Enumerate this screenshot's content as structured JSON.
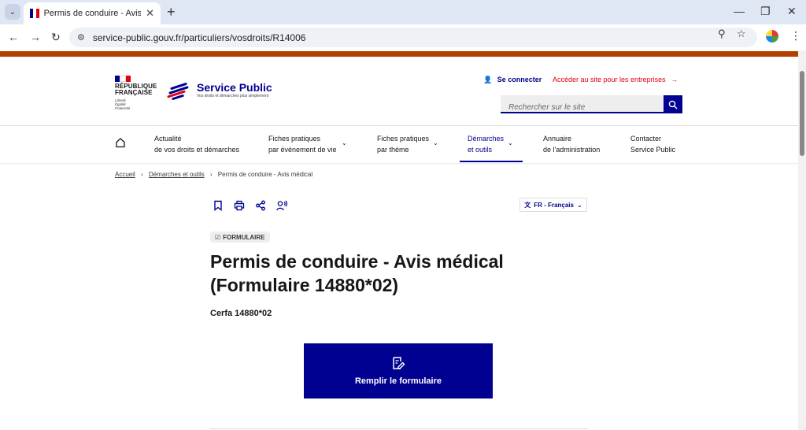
{
  "browser": {
    "tab_title": "Permis de conduire - Avis médical",
    "url": "service-public.gouv.fr/particuliers/vosdroits/R14006"
  },
  "header": {
    "marianne_lines": [
      "RÉPUBLIQUE",
      "FRANÇAISE"
    ],
    "devise": [
      "Liberté",
      "Égalité",
      "Fraternité"
    ],
    "site_title": "Service Public",
    "site_tagline": "Vos droits et démarches plus simplement",
    "connect_label": "Se connecter",
    "pro_link": "Accéder au site pour les entreprises",
    "search_placeholder": "Rechercher sur le site"
  },
  "nav": {
    "items": [
      {
        "line1": "Actualité",
        "line2": "de vos droits et démarches"
      },
      {
        "line1": "Fiches pratiques",
        "line2": "par événement de vie"
      },
      {
        "line1": "Fiches pratiques",
        "line2": "par thème"
      },
      {
        "line1": "Démarches",
        "line2": "et outils"
      },
      {
        "line1": "Annuaire",
        "line2": "de l'administration"
      },
      {
        "line1": "Contacter",
        "line2": "Service Public"
      }
    ]
  },
  "breadcrumb": {
    "items": [
      "Accueil",
      "Démarches et outils",
      "Permis de conduire - Avis médical"
    ]
  },
  "language": "FR - Français",
  "content": {
    "badge": "FORMULAIRE",
    "title_line1": "Permis de conduire - Avis médical",
    "title_line2": "(Formulaire 14880*02)",
    "cerfa": "Cerfa 14880*02",
    "cta_label": "Remplir le formulaire"
  },
  "colors": {
    "brand_blue": "#000091",
    "accent_bar": "#b34000",
    "marianne_red": "#e1000f"
  }
}
